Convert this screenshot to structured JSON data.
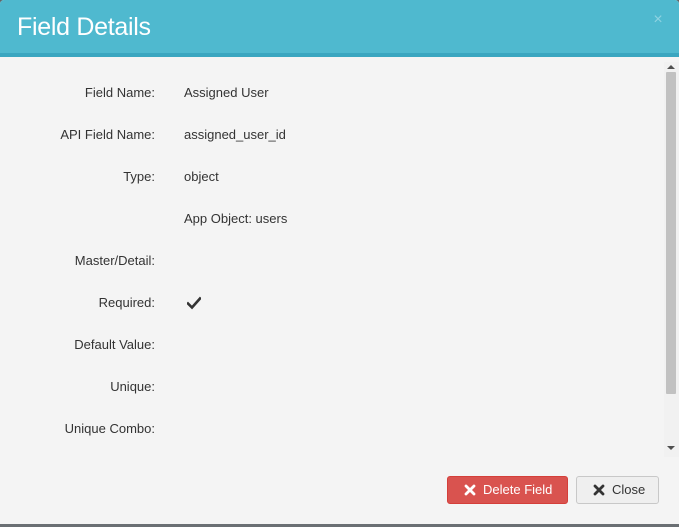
{
  "modal": {
    "title": "Field Details",
    "close_symbol": "×"
  },
  "fields": [
    {
      "label": "Field Name:",
      "value": "Assigned User"
    },
    {
      "label": "API Field Name:",
      "value": "assigned_user_id"
    },
    {
      "label": "Type:",
      "value": "object"
    },
    {
      "label": "",
      "value": "App Object: users"
    },
    {
      "label": "Master/Detail:",
      "value": ""
    },
    {
      "label": "Required:",
      "value": "",
      "icon": "check-icon"
    },
    {
      "label": "Default Value:",
      "value": ""
    },
    {
      "label": "Unique:",
      "value": ""
    },
    {
      "label": "Unique Combo:",
      "value": ""
    }
  ],
  "footer": {
    "delete_label": "Delete Field",
    "close_label": "Close",
    "delete_icon": "times-icon",
    "close_icon": "times-icon"
  },
  "colors": {
    "header": "#4fb9cf",
    "danger": "#d9534f",
    "background": "#f4f4f4"
  }
}
